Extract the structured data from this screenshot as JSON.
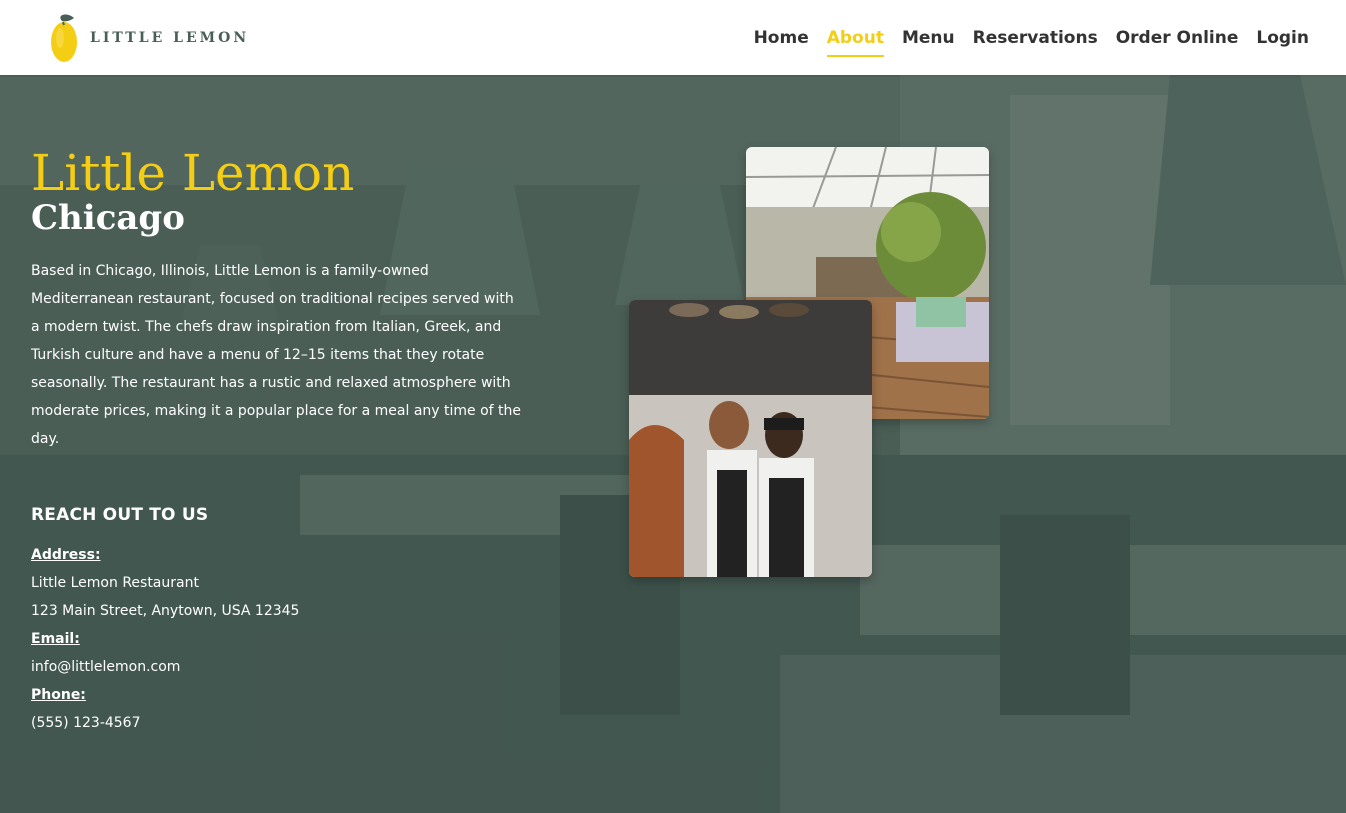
{
  "brand": {
    "name": "LITTLE LEMON",
    "primary": "#495e57",
    "accent": "#f4ce14"
  },
  "nav": {
    "items": [
      {
        "label": "Home",
        "active": false
      },
      {
        "label": "About",
        "active": true
      },
      {
        "label": "Menu",
        "active": false
      },
      {
        "label": "Reservations",
        "active": false
      },
      {
        "label": "Order Online",
        "active": false
      },
      {
        "label": "Login",
        "active": false
      }
    ]
  },
  "hero": {
    "title": "Little Lemon",
    "subtitle": "Chicago",
    "description": "Based in Chicago, Illinois, Little Lemon is a family-owned Mediterranean restaurant, focused on traditional recipes served with a modern twist. The chefs draw inspiration from Italian, Greek, and Turkish culture and have a menu of 12–15 items that they rotate seasonally. The restaurant has a rustic and relaxed atmosphere with moderate prices, making it a popular place for a meal any time of the day."
  },
  "contact": {
    "heading": "REACH OUT TO US",
    "address_label": "Address:",
    "address_line1": "Little Lemon Restaurant",
    "address_line2": "123 Main Street, Anytown, USA 12345",
    "email_label": "Email:",
    "email": "info@littlelemon.com",
    "phone_label": "Phone:",
    "phone": "(555) 123-4567"
  }
}
